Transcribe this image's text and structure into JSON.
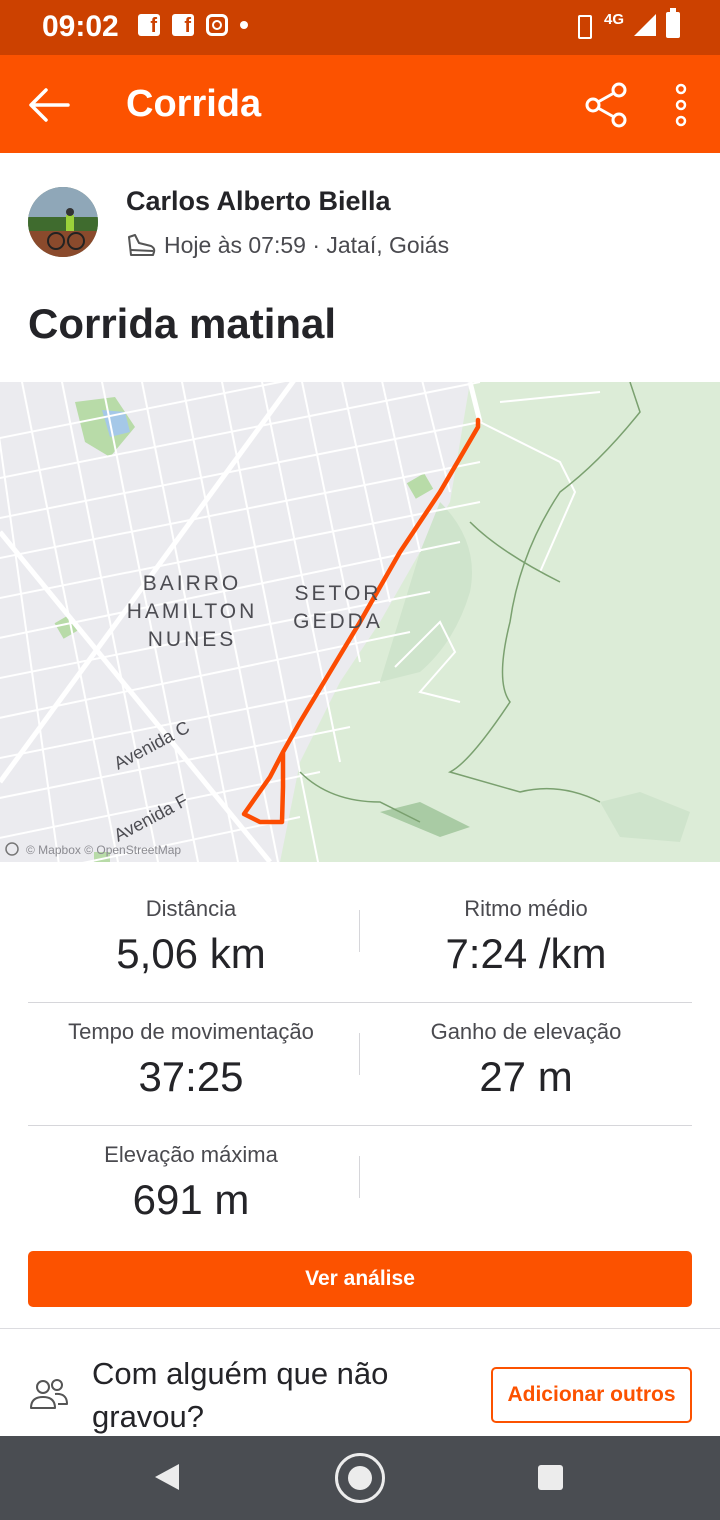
{
  "status_bar": {
    "time": "09:02",
    "network": "4G",
    "icons": [
      "facebook-icon",
      "facebook-icon",
      "instagram-icon",
      "dot-icon",
      "vibrate-icon",
      "signal-icon",
      "battery-icon"
    ]
  },
  "app_bar": {
    "title": "Corrida",
    "back_icon": "arrow-left-icon",
    "share_icon": "share-icon",
    "more_icon": "more-vertical-icon"
  },
  "athlete": {
    "name": "Carlos Alberto Biella",
    "activity_icon": "shoe-icon",
    "meta": "Hoje às 07:59 · Jataí, Goiás"
  },
  "activity": {
    "title": "Corrida matinal"
  },
  "map": {
    "labels": {
      "bairro_line1": "BAIRRO",
      "bairro_line2": "HAMILTON",
      "bairro_line3": "NUNES",
      "setor_line1": "SETOR",
      "setor_line2": "GEDDA",
      "avenida_c": "Avenida C",
      "avenida_f": "Avenida F",
      "attribution": "© Mapbox © OpenStreetMap"
    },
    "route_color": "#fc4c02",
    "park_color": "#d9ead3"
  },
  "stats": [
    {
      "label": "Distância",
      "value": "5,06 km"
    },
    {
      "label": "Ritmo médio",
      "value": "7:24 /km"
    },
    {
      "label": "Tempo de movimentação",
      "value": "37:25"
    },
    {
      "label": "Ganho de elevação",
      "value": "27 m"
    },
    {
      "label": "Elevação máxima",
      "value": "691 m"
    }
  ],
  "buttons": {
    "analysis": "Ver análise",
    "add_others": "Adicionar outros"
  },
  "companions": {
    "icon": "group-icon",
    "text": "Com alguém que não gravou?"
  },
  "colors": {
    "brand": "#fc5200",
    "status_bar": "#cc4100",
    "nav_bar": "#4a4d52"
  }
}
